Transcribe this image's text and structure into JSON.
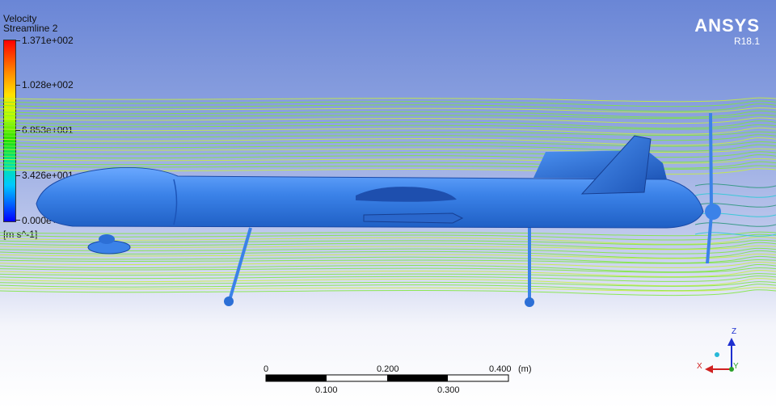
{
  "legend": {
    "variable": "Velocity",
    "object": "Streamline 2",
    "ticks": [
      "1.371e+002",
      "1.028e+002",
      "6.853e+001",
      "3.426e+001",
      "0.000e+000"
    ],
    "units": "[m s^-1]"
  },
  "brand": {
    "name": "ANSYS",
    "version": "R18.1"
  },
  "scale_bar": {
    "top_labels": [
      "0",
      "0.200",
      "0.400"
    ],
    "unit": "(m)",
    "bottom_labels": [
      "0.100",
      "0.300"
    ]
  },
  "triad": {
    "z": "Z",
    "x": "X",
    "y": "Y"
  },
  "colors": {
    "body": "#3b82e8",
    "streamline_green": "#7ee83a",
    "streamline_yellow": "#c8f03a"
  }
}
